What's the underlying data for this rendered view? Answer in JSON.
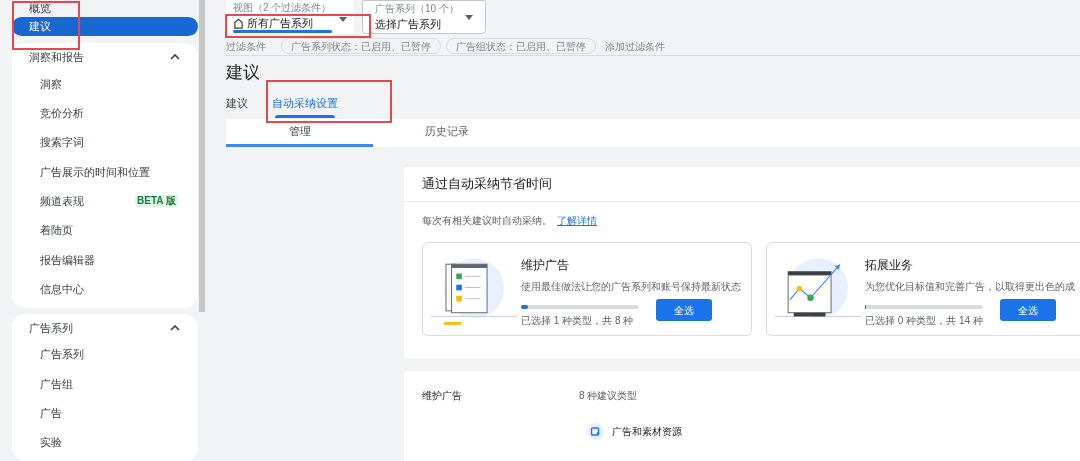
{
  "sidebar": {
    "top_items": [
      {
        "label": "概览",
        "selected": false
      },
      {
        "label": "建议",
        "selected": true
      }
    ],
    "groups": [
      {
        "title": "洞察和报告",
        "expanded": true,
        "items": [
          {
            "label": "洞察"
          },
          {
            "label": "竞价分析"
          },
          {
            "label": "搜索字词"
          },
          {
            "label": "广告展示的时间和位置"
          },
          {
            "label": "频道表现",
            "badge": "BETA 版"
          },
          {
            "label": "着陆页"
          },
          {
            "label": "报告编辑器"
          },
          {
            "label": "信息中心"
          }
        ]
      },
      {
        "title": "广告系列",
        "expanded": true,
        "items": [
          {
            "label": "广告系列"
          },
          {
            "label": "广告组"
          },
          {
            "label": "广告"
          },
          {
            "label": "实验"
          }
        ]
      }
    ]
  },
  "view_selector": {
    "label": "视图（2 个过滤条件）",
    "value": "所有广告系列"
  },
  "campaign_selector": {
    "label": "广告系列（10 个）",
    "value": "选择广告系列"
  },
  "filters": {
    "label": "过滤条件",
    "chips": [
      "广告系列状态：已启用、已暂停",
      "广告组状态：已启用、已暂停"
    ],
    "add": "添加过滤条件"
  },
  "page_title": "建议",
  "tabs": [
    {
      "label": "建议",
      "selected": false
    },
    {
      "label": "自动采纳设置",
      "selected": true
    }
  ],
  "subtabs": [
    {
      "label": "管理",
      "selected": true
    },
    {
      "label": "历史记录",
      "selected": false
    }
  ],
  "auto_apply_card": {
    "title": "通过自动采纳节省时间",
    "description": "每次有相关建议时自动采纳。",
    "link": "了解详情",
    "options": [
      {
        "kind": "maintain",
        "title": "维护广告",
        "description": "使用最佳做法让您的广告系列和账号保持最新状态",
        "level": 0.06,
        "count": "已选择 1 种类型，共 8 种",
        "button": "全选"
      },
      {
        "kind": "grow",
        "title": "拓展业务",
        "description": "为您优化目标值和完善广告，以取得更出色的成",
        "level": 0,
        "count": "已选择 0 种类型，共 14 种",
        "button": "全选"
      }
    ]
  },
  "details_card": {
    "label": "维护广告",
    "summary": "8 种建议类型",
    "items": [
      "广告和素材资源"
    ]
  }
}
